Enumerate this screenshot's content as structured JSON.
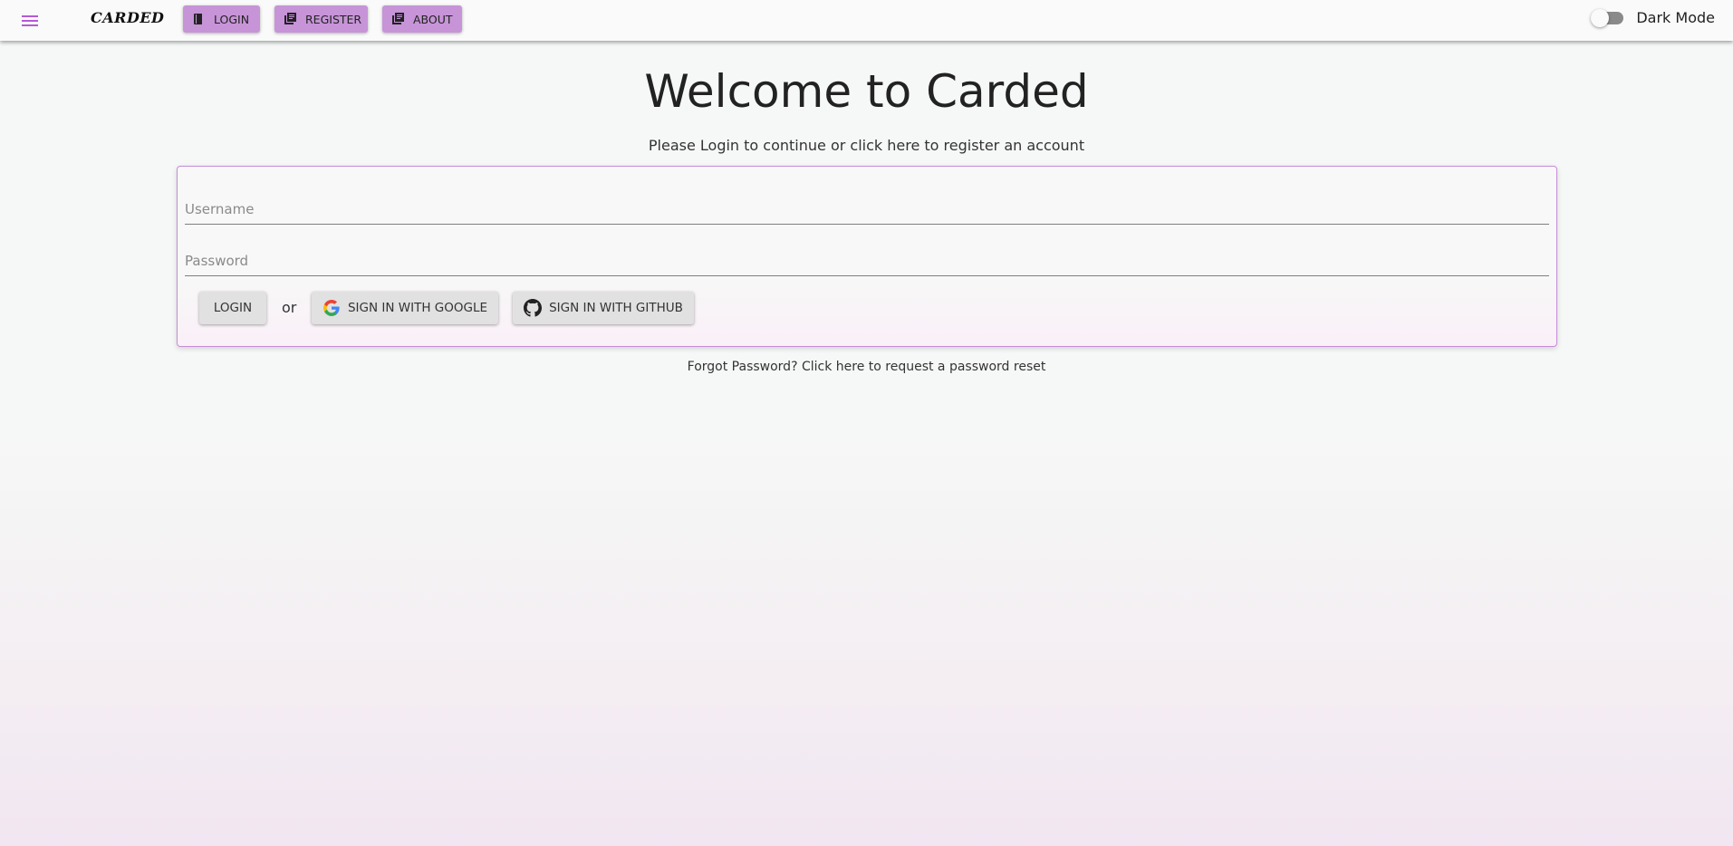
{
  "app": {
    "brand": "CARDED",
    "accent_color": "#c794d8",
    "menu_icon": "menu-icon"
  },
  "nav": {
    "items": [
      {
        "label": "LOGIN",
        "icon": "book-icon"
      },
      {
        "label": "REGISTER",
        "icon": "library-icon"
      },
      {
        "label": "ABOUT",
        "icon": "library-icon"
      }
    ]
  },
  "dark_mode": {
    "label": "Dark Mode",
    "enabled": false
  },
  "main": {
    "title": "Welcome to Carded",
    "subtitle": "Please Login to continue or click here to register an account",
    "form": {
      "username_placeholder": "Username",
      "password_placeholder": "Password",
      "username_value": "",
      "password_value": "",
      "login_label": "LOGIN",
      "or_text": "or",
      "google_label": "SIGN IN WITH GOOGLE",
      "github_label": "SIGN IN WITH GITHUB"
    },
    "forgot_text": "Forgot Password? Click here to request a password reset"
  }
}
